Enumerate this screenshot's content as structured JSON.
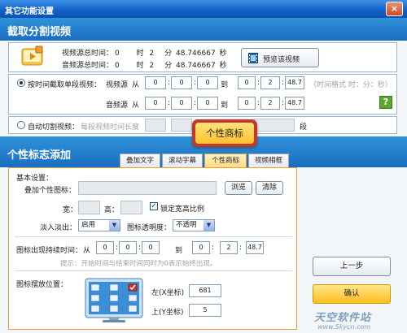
{
  "window": {
    "title": "其它功能设置",
    "close": "×"
  },
  "section1": {
    "title": "截取分割视频"
  },
  "info": {
    "video_label": "视频源总时间：",
    "audio_label": "音频源总时间：",
    "video_h": "0",
    "video_m": "2",
    "video_s": "48.746667",
    "audio_h": "0",
    "audio_m": "2",
    "audio_s": "48.746667",
    "hour_unit": "时",
    "min_unit": "分",
    "sec_unit": "秒",
    "preview_button": "预览该视频"
  },
  "by_time": {
    "label": "按时间截取单段视频：",
    "video_src": "视频源",
    "audio_src": "音频源",
    "from": "从",
    "to": "到",
    "format_hint": "（时间格式 时：分：秒）",
    "help": "?",
    "video_start": [
      "0",
      "0",
      "0"
    ],
    "video_end": [
      "0",
      "2",
      "48.7"
    ],
    "audio_start": [
      "0",
      "0",
      "0"
    ],
    "audio_end": [
      "0",
      "2",
      "48.7"
    ]
  },
  "auto_cut": {
    "label": "自动切割视频：",
    "segment_label": "每段视频时间长度",
    "unit": "段"
  },
  "section2": {
    "title": "个性标志添加"
  },
  "tabs": [
    {
      "label": "叠加文字"
    },
    {
      "label": "滚动字幕"
    },
    {
      "label": "个性商标"
    },
    {
      "label": "视频相框"
    }
  ],
  "callout": {
    "label": "个性商标"
  },
  "basic": {
    "title": "基本设置：",
    "overlay_label": "叠加个性图标：",
    "browse": "浏览",
    "clear": "清除",
    "width_label": "宽：",
    "height_label": "高：",
    "lock_ratio": "锁定宽高比例",
    "fade_label": "淡入淡出：",
    "fade_value": "启用",
    "opacity_label": "图标透明度：",
    "opacity_value": "不透明"
  },
  "duration": {
    "label": "图标出现持续时间：",
    "from": "从",
    "to": "到",
    "start": [
      "0",
      "0",
      "0"
    ],
    "end": [
      "0",
      "2",
      "48.7"
    ],
    "hint": "提示：开始时间与结束时间同时为0表示始终出现。"
  },
  "position": {
    "label": "图标摆放位置：",
    "left_label": "左(X坐标)",
    "left_value": "681",
    "top_label": "上(Y坐标)",
    "top_value": "5"
  },
  "buttons": {
    "prev": "上一步",
    "confirm": "确认"
  },
  "watermark": {
    "brand": "天空软件站",
    "url": "www.Skycn.com"
  }
}
